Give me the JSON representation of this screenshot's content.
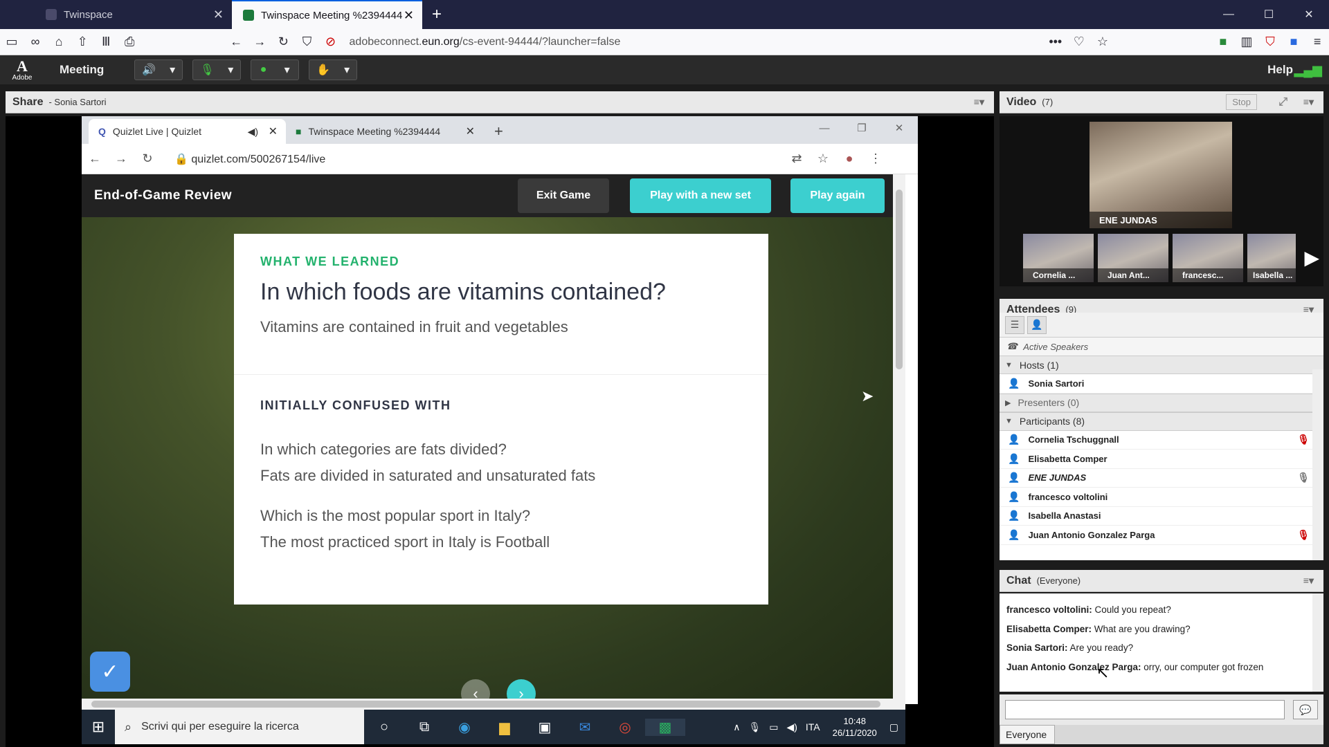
{
  "browser": {
    "tabs": [
      {
        "title": "Twinspace"
      },
      {
        "title": "Twinspace Meeting %2394444"
      }
    ],
    "url_prefix": "adobeconnect.",
    "url_domain": "eun.org",
    "url_path": "/cs-event-94444/?launcher=false"
  },
  "adobe": {
    "logo_text": "Adobe",
    "menu_meeting": "Meeting",
    "help": "Help"
  },
  "share_pod": {
    "title": "Share",
    "presenter": "- Sonia Sartori"
  },
  "chrome": {
    "tabs": [
      {
        "title": "Quizlet Live | Quizlet"
      },
      {
        "title": "Twinspace Meeting %2394444"
      }
    ],
    "url": "quizlet.com/500267154/live"
  },
  "quiz": {
    "header_title": "End-of-Game Review",
    "exit_label": "Exit Game",
    "new_set_label": "Play with a new set",
    "again_label": "Play again",
    "learned_label": "WHAT WE LEARNED",
    "question": "In which foods are vitamins contained?",
    "answer": "Vitamins are contained in fruit and vegetables",
    "confused_label": "INITIALLY CONFUSED WITH",
    "confused": [
      {
        "q": "In which categories are fats divided?",
        "a": "Fats are divided in saturated and unsaturated fats"
      },
      {
        "q": "Which is the most popular sport in Italy?",
        "a": "The most practiced sport in Italy is Football"
      }
    ]
  },
  "taskbar": {
    "search_placeholder": "Scrivi qui per eseguire la ricerca",
    "lang": "ITA",
    "time": "10:48",
    "date": "26/11/2020"
  },
  "video_pod": {
    "title": "Video",
    "count": "(7)",
    "stop_label": "Stop",
    "main_name": "ENE JUNDAS",
    "thumbs": [
      "Cornelia ...",
      "Juan Ant...",
      "francesc...",
      "Isabella ..."
    ]
  },
  "attendees_pod": {
    "title": "Attendees",
    "count": "(9)",
    "active_speakers": "Active Speakers",
    "hosts_label": "Hosts (1)",
    "hosts": [
      "Sonia Sartori"
    ],
    "presenters_label": "Presenters (0)",
    "participants_label": "Participants (8)",
    "participants": [
      {
        "name": "Cornelia Tschuggnall",
        "mic": "muted"
      },
      {
        "name": "Elisabetta Comper",
        "mic": ""
      },
      {
        "name": "ENE JUNDAS",
        "mic": "speaking"
      },
      {
        "name": "francesco voltolini",
        "mic": ""
      },
      {
        "name": "Isabella Anastasi",
        "mic": ""
      },
      {
        "name": "Juan Antonio Gonzalez Parga",
        "mic": "muted"
      }
    ]
  },
  "chat_pod": {
    "title": "Chat",
    "scope": "(Everyone)",
    "messages": [
      {
        "from": "francesco voltolini:",
        "text": " Could you repeat?"
      },
      {
        "from": "Elisabetta Comper:",
        "text": " What are you drawing?"
      },
      {
        "from": "Sonia Sartori:",
        "text": " Are you ready?"
      },
      {
        "from": "Juan Antonio Gonzalez Parga:",
        "text": " orry, our computer got frozen"
      }
    ],
    "target": "Everyone"
  }
}
